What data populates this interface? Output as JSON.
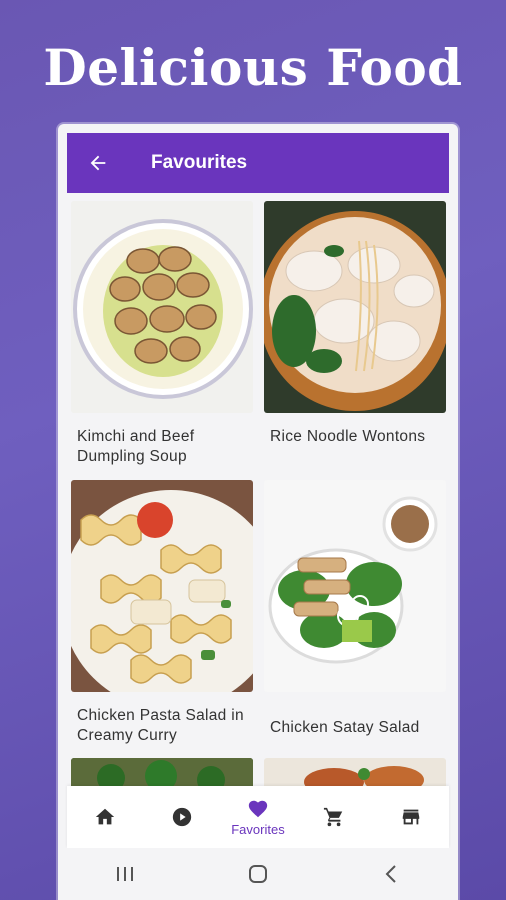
{
  "promo": {
    "headline": "Delicious Food"
  },
  "appbar": {
    "title": "Favourites",
    "back_icon": "arrow-back-icon"
  },
  "recipes": [
    {
      "title": "Kimchi and Beef Dumpling Soup"
    },
    {
      "title": "Rice Noodle Wontons"
    },
    {
      "title": "Chicken Pasta Salad in Creamy Curry"
    },
    {
      "title": "Chicken Satay Salad"
    }
  ],
  "bottom_nav": {
    "items": [
      {
        "icon": "home-icon",
        "label": ""
      },
      {
        "icon": "play-circle-icon",
        "label": ""
      },
      {
        "icon": "heart-icon",
        "label": "Favorites",
        "active": true
      },
      {
        "icon": "cart-icon",
        "label": ""
      },
      {
        "icon": "store-icon",
        "label": ""
      }
    ]
  },
  "system_nav": {
    "items": [
      "recents-icon",
      "home-circle-icon",
      "back-chevron-icon"
    ]
  },
  "colors": {
    "primary": "#6a35bd",
    "background_gradient": [
      "#6a57b3",
      "#5b4aa8"
    ],
    "text": "#333333"
  }
}
